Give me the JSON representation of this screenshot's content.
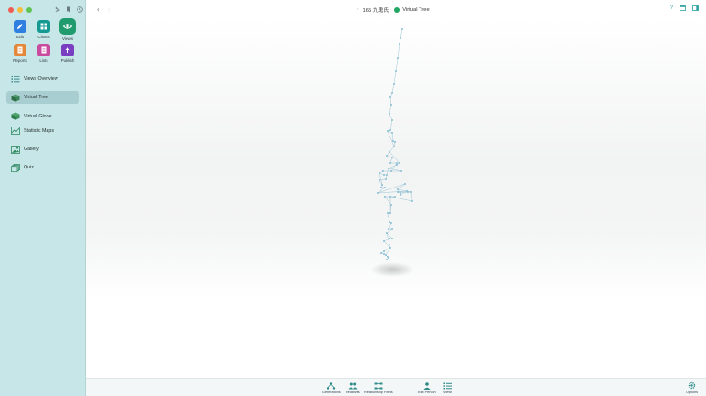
{
  "titlebar": {
    "person_label": "165 九鬼氏",
    "view_label": "Virtual Tree",
    "colors": {
      "accent": "#2a9f9e",
      "view_dot": "#22a664"
    }
  },
  "app_buttons": [
    {
      "label": "Edit",
      "icon": "pencil-icon",
      "color": "#2f7fe0"
    },
    {
      "label": "Charts",
      "icon": "charts-icon",
      "color": "#159a93"
    },
    {
      "label": "Views",
      "icon": "eye-icon",
      "color": "#1f9b6e",
      "selected": true
    },
    {
      "label": "Reports",
      "icon": "reports-icon",
      "color": "#e5873a"
    },
    {
      "label": "Lists",
      "icon": "lists-icon",
      "color": "#c84b9e"
    },
    {
      "label": "Publish",
      "icon": "publish-icon",
      "color": "#7a3fc0"
    }
  ],
  "nav_items": [
    {
      "label": "Views Overview",
      "icon": "list-icon"
    },
    {
      "label": "Virtual Tree",
      "icon": "cube-icon",
      "active": true
    },
    {
      "label": "Virtual Globe",
      "icon": "globe-icon"
    },
    {
      "label": "Statistic Maps",
      "icon": "map-icon"
    },
    {
      "label": "Gallery",
      "icon": "image-icon"
    },
    {
      "label": "Quiz",
      "icon": "cards-icon"
    }
  ],
  "bottom_toolbar": [
    {
      "label": "Generations",
      "icon": "generations-icon"
    },
    {
      "label": "Relatives",
      "icon": "relatives-icon"
    },
    {
      "label": "Relationship Paths",
      "icon": "relationship-paths-icon"
    },
    {
      "label": "Edit Person",
      "icon": "person-icon"
    },
    {
      "label": "Views",
      "icon": "views-icon"
    },
    {
      "label": "Options",
      "icon": "gear-icon"
    }
  ]
}
